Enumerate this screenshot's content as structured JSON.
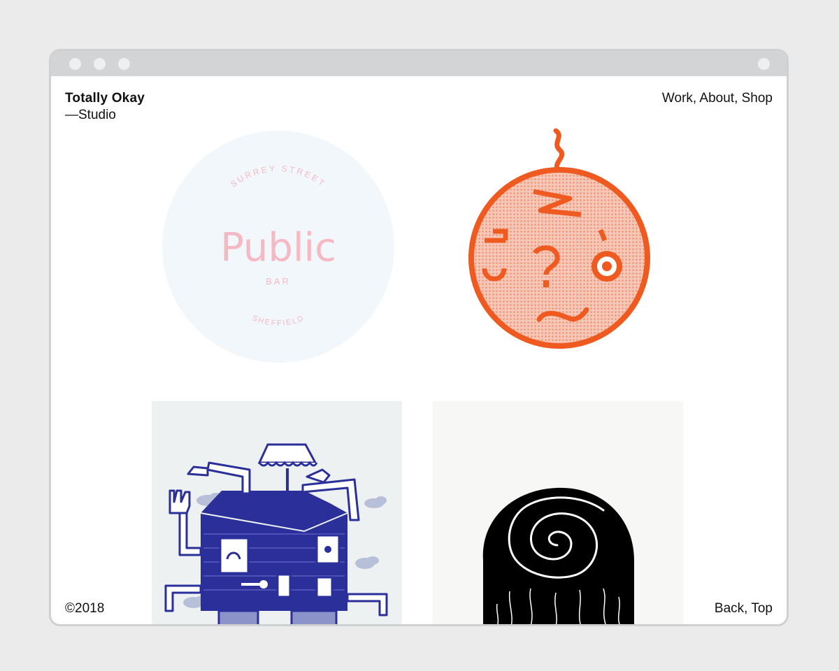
{
  "site": {
    "brand_name": "Totally Okay",
    "brand_sub": "—Studio"
  },
  "nav": {
    "items": [
      "Work",
      "About",
      "Shop"
    ],
    "sep1": ", ",
    "sep2": ", "
  },
  "tiles": {
    "public_bar": {
      "top_text": "SURREY STREET",
      "title": "Public",
      "subtitle": "BAR",
      "bottom_text": "SHEFFIELD"
    }
  },
  "footer": {
    "copyright": "©2018",
    "back_label": "Back",
    "sep": ", ",
    "top_label": "Top"
  },
  "colors": {
    "window_border": "#cfd0d2",
    "pale_blue": "#f2f7fb",
    "pink": "#f4b9c2",
    "orange": "#ee5a1f",
    "navy": "#2b2f9a",
    "tile_bg_blue": "#edf1f1",
    "tile_bg_white": "#f7f7f6"
  }
}
